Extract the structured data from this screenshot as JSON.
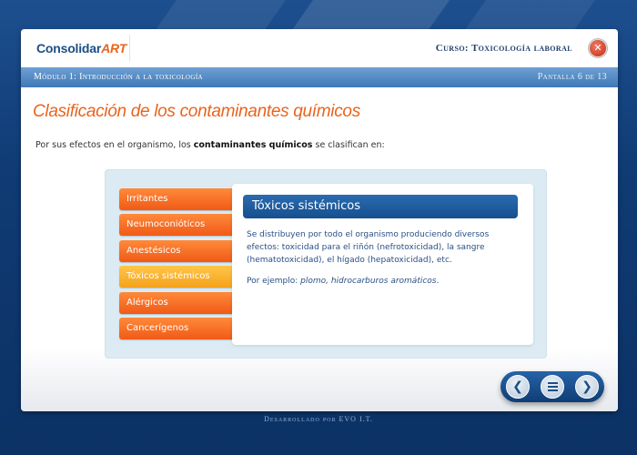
{
  "header": {
    "logo_main": "Consolidar",
    "logo_accent": "ART",
    "course": "Curso: Toxicología laboral",
    "close_glyph": "✕"
  },
  "module_bar": {
    "title": "Módulo 1: Introducción a la toxicología",
    "screen": "Pantalla 6 de 13"
  },
  "page": {
    "title": "Clasificación de los contaminantes químicos",
    "intro_before": "Por sus efectos en el organismo, los ",
    "intro_bold": "contaminantes químicos",
    "intro_after": " se clasifican en:"
  },
  "menu": {
    "items": [
      {
        "label": "Irritantes"
      },
      {
        "label": "Neumoconióticos"
      },
      {
        "label": "Anestésicos"
      },
      {
        "label": "Tóxicos sistémicos"
      },
      {
        "label": "Alérgicos"
      },
      {
        "label": "Cancerígenos"
      }
    ],
    "selected": "Tóxicos sistémicos"
  },
  "content": {
    "title": "Tóxicos sistémicos",
    "description": "Se distribuyen por todo el organismo produciendo diversos efectos: toxicidad para el riñón (nefrotoxicidad), la sangre (hematotoxicidad), el hígado (hepatoxicidad), etc.",
    "example_label": "Por ejemplo: ",
    "example_items": "plomo, hidrocarburos aromáticos",
    "example_end": "."
  },
  "nav": {
    "prev_icon": "chevron-left-icon",
    "menu_icon": "menu-icon",
    "next_icon": "chevron-right-icon",
    "prev_glyph": "❮",
    "next_glyph": "❯"
  },
  "footer": {
    "text": "Desarrollado por EVO I.T."
  },
  "colors": {
    "accent_orange": "#e8641e",
    "brand_blue": "#1b4f86",
    "active_item": "#f5a21b"
  }
}
